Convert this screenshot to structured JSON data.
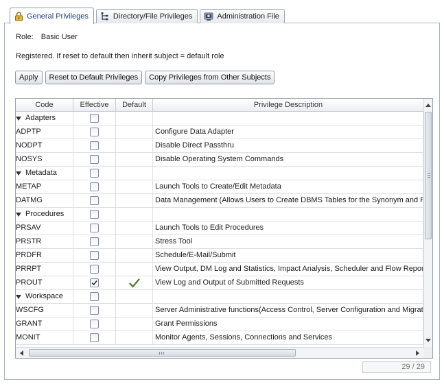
{
  "tabs": [
    {
      "label": "General Privileges",
      "icon": "lock-icon",
      "active": true
    },
    {
      "label": "Directory/File Privileges",
      "icon": "directory-tree-icon",
      "active": false
    },
    {
      "label": "Administration File",
      "icon": "admin-console-icon",
      "active": false
    }
  ],
  "role": {
    "label": "Role:",
    "value": "Basic User"
  },
  "registered_text": "Registered. If reset to default then inherit subject = default role",
  "buttons": {
    "apply": "Apply",
    "reset": "Reset to Default Privileges",
    "copy": "Copy Privileges from Other Subjects"
  },
  "table": {
    "headers": {
      "code": "Code",
      "effective": "Effective",
      "default": "Default",
      "description": "Privilege Description"
    },
    "rows": [
      {
        "type": "group",
        "code": "Adapters",
        "effective": false,
        "default": false,
        "description": ""
      },
      {
        "type": "item",
        "code": "ADPTP",
        "effective": false,
        "default": false,
        "description": "Configure Data Adapter"
      },
      {
        "type": "item",
        "code": "NODPT",
        "effective": false,
        "default": false,
        "description": "Disable Direct Passthru"
      },
      {
        "type": "item",
        "code": "NOSYS",
        "effective": false,
        "default": false,
        "description": "Disable Operating System Commands"
      },
      {
        "type": "group",
        "code": "Metadata",
        "effective": false,
        "default": false,
        "description": ""
      },
      {
        "type": "item",
        "code": "METAP",
        "effective": false,
        "default": false,
        "description": "Launch Tools to Create/Edit Metadata"
      },
      {
        "type": "item",
        "code": "DATMG",
        "effective": false,
        "default": false,
        "description": "Data Management (Allows Users to Create DBMS Tables for the Synonym and Re"
      },
      {
        "type": "group",
        "code": "Procedures",
        "effective": false,
        "default": false,
        "description": ""
      },
      {
        "type": "item",
        "code": "PRSAV",
        "effective": false,
        "default": false,
        "description": "Launch Tools to Edit Procedures"
      },
      {
        "type": "item",
        "code": "PRSTR",
        "effective": false,
        "default": false,
        "description": "Stress Tool"
      },
      {
        "type": "item",
        "code": "PRDFR",
        "effective": false,
        "default": false,
        "description": "Schedule/E-Mail/Submit"
      },
      {
        "type": "item",
        "code": "PRRPT",
        "effective": false,
        "default": false,
        "description": "View Output, DM Log and Statistics, Impact Analysis, Scheduler and Flow Reports"
      },
      {
        "type": "item",
        "code": "PROUT",
        "effective": true,
        "default": true,
        "description": "View Log and Output of Submitted Requests"
      },
      {
        "type": "group",
        "code": "Workspace",
        "effective": false,
        "default": false,
        "description": ""
      },
      {
        "type": "item",
        "code": "WSCFG",
        "effective": false,
        "default": false,
        "description": "Server Administrative functions(Access Control, Server Configuration and Migrati"
      },
      {
        "type": "item",
        "code": "GRANT",
        "effective": false,
        "default": false,
        "description": "Grant Permissions"
      },
      {
        "type": "item",
        "code": "MONIT",
        "effective": false,
        "default": false,
        "description": "Monitor Agents, Sessions, Connections and Services"
      }
    ]
  },
  "counter": "29 / 29",
  "colors": {
    "checkmark": "#4d7a2a",
    "active_tab_text": "#1d3e7a"
  }
}
